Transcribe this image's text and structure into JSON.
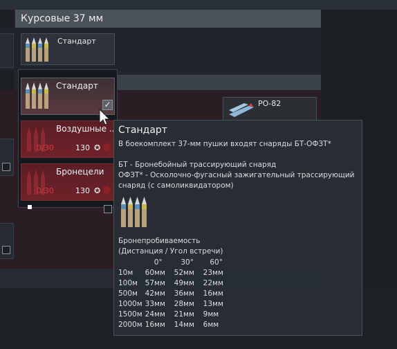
{
  "section_title": "Курсовые 37 мм",
  "slot_card": {
    "label": "Стандарт"
  },
  "dropdown": {
    "items": [
      {
        "label": "Стандарт",
        "selected": true
      },
      {
        "label": "Воздушные ...",
        "count": "0/30",
        "price": "130"
      },
      {
        "label": "Бронецели",
        "count": "0/30",
        "price": "130"
      }
    ]
  },
  "ro_card": {
    "label": "РО-82"
  },
  "tooltip": {
    "title": "Стандарт",
    "subtitle": "В боекомплект 37-мм пушки входят снаряды БТ-ОФЗТ*",
    "desc_lines": [
      "БТ - Бронебойный трассирующий снаряд",
      "ОФЗТ* - Осколочно-фугасный зажигательный трассирующий",
      "снаряд (с самоликвидатором)"
    ],
    "pen_title": "Бронепробиваемость",
    "pen_subtitle": "(Дистанция / Угол встречи)",
    "angles": [
      "0°",
      "30°",
      "60°"
    ],
    "rows": [
      [
        "10м",
        "60мм",
        "52мм",
        "23мм"
      ],
      [
        "100м",
        "57мм",
        "49мм",
        "22мм"
      ],
      [
        "500м",
        "42мм",
        "36мм",
        "16мм"
      ],
      [
        "1000м",
        "33мм",
        "28мм",
        "13мм"
      ],
      [
        "1500м",
        "24мм",
        "21мм",
        "9мм"
      ],
      [
        "2000м",
        "16мм",
        "14мм",
        "6мм"
      ]
    ]
  },
  "colors": {
    "accent_red": "#7b2d33",
    "count_red": "#d0393d",
    "header_bg": "#4b5258"
  }
}
